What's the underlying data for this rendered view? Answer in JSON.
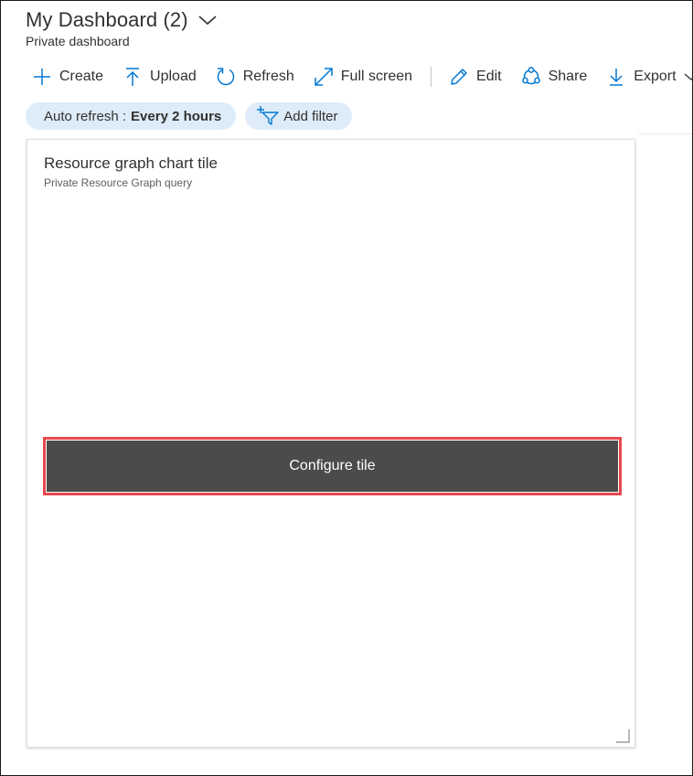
{
  "header": {
    "title": "My Dashboard (2)",
    "subtitle": "Private dashboard"
  },
  "toolbar": {
    "create": "Create",
    "upload": "Upload",
    "refresh": "Refresh",
    "fullscreen": "Full screen",
    "edit": "Edit",
    "share": "Share",
    "export": "Export"
  },
  "filters": {
    "auto_refresh_label": "Auto refresh :",
    "auto_refresh_value": "Every 2 hours",
    "add_filter": "Add filter"
  },
  "tile": {
    "title": "Resource graph chart tile",
    "subtitle": "Private Resource Graph query",
    "configure_label": "Configure tile"
  },
  "colors": {
    "accent": "#0078d4",
    "pill_bg": "#deecf9",
    "configure_bg": "#4b4b4b",
    "highlight_border": "#e8474f"
  },
  "icons": [
    "chevron-down-icon",
    "plus-icon",
    "upload-icon",
    "refresh-icon",
    "full-screen-icon",
    "edit-icon",
    "share-icon",
    "export-icon",
    "add-filter-icon",
    "resize-handle-icon"
  ]
}
